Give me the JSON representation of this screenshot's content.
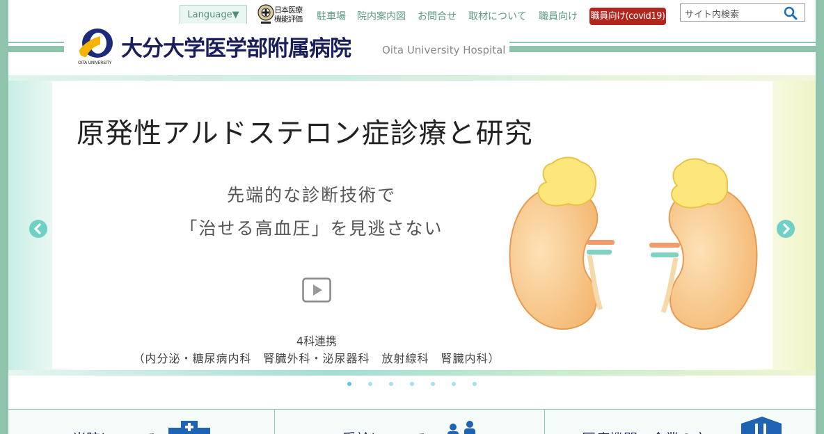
{
  "header": {
    "language_label": "Language▼",
    "jq_label": "日本医療機能評価",
    "nav": [
      "駐車場",
      "院内案内図",
      "お問合せ",
      "取材について",
      "職員向け"
    ],
    "covid_label": "職員向け(covid19)",
    "search_placeholder": "サイト内検索",
    "univ_mark_text": "OITA UNIVERSITY",
    "title": "大分大学医学部附属病院",
    "subtitle": "Oita University Hospital"
  },
  "hero": {
    "title": "原発性アルドステロン症診療と研究",
    "line1": "先端的な診断技術で",
    "line2": "「治せる高血圧」を見逃さない",
    "line3": "4科連携",
    "line4": "（内分泌・糖尿病内科　腎臓外科・泌尿器科　放射線科　腎臓内科）",
    "dots_count": 7,
    "active_dot": 0
  },
  "bottom": {
    "items": [
      "当院について",
      "受診について",
      "医療機関・企業の方へ"
    ]
  },
  "colors": {
    "frame": "#8fc3ac",
    "title_navy": "#1a1e5a",
    "nav_green": "#5c9a86",
    "covid_red": "#b3261e",
    "arrow_teal": "#6fd0c6",
    "dot_active": "#5cc8d6",
    "dot_inactive": "#a7e0e4"
  }
}
